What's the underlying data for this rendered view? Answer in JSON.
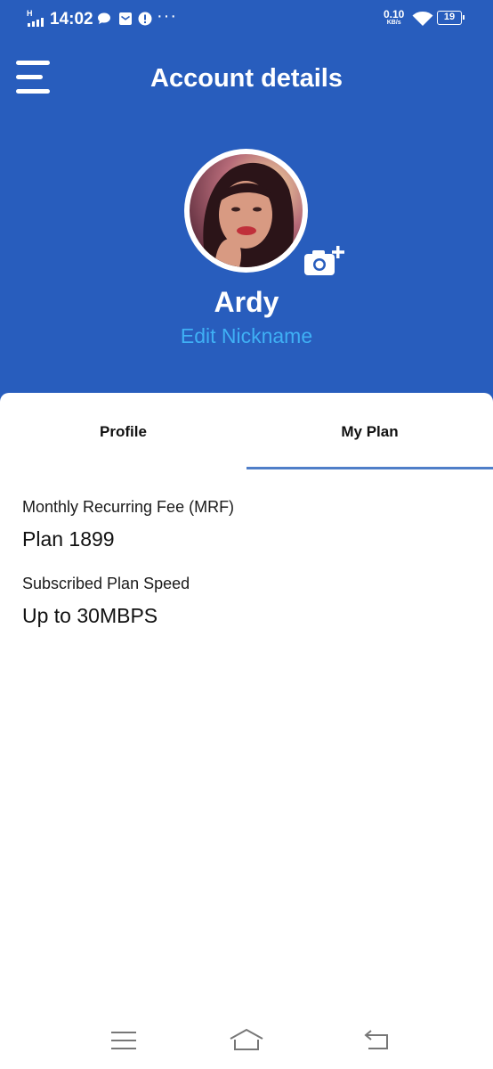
{
  "status_bar": {
    "network_type": "H",
    "time": "14:02",
    "more": "···",
    "speed_value": "0.10",
    "speed_unit": "KB/s",
    "battery": "19"
  },
  "header": {
    "title": "Account details",
    "profile_name": "Ardy",
    "edit_nickname": "Edit Nickname"
  },
  "tabs": [
    {
      "label": "Profile",
      "active": false
    },
    {
      "label": "My Plan",
      "active": true
    }
  ],
  "plan": {
    "mrf_label": "Monthly Recurring Fee (MRF)",
    "mrf_value": "Plan 1899",
    "speed_label": "Subscribed Plan Speed",
    "speed_value": "Up to 30MBPS"
  },
  "icons": {
    "menu": "hamburger-menu-icon",
    "camera": "camera-plus-icon",
    "nav_recent": "recent-apps-icon",
    "nav_home": "home-icon",
    "nav_back": "back-icon"
  },
  "colors": {
    "header_bg": "#285dbd",
    "link": "#3fb0f5",
    "tab_underline": "#4f7ec8"
  }
}
